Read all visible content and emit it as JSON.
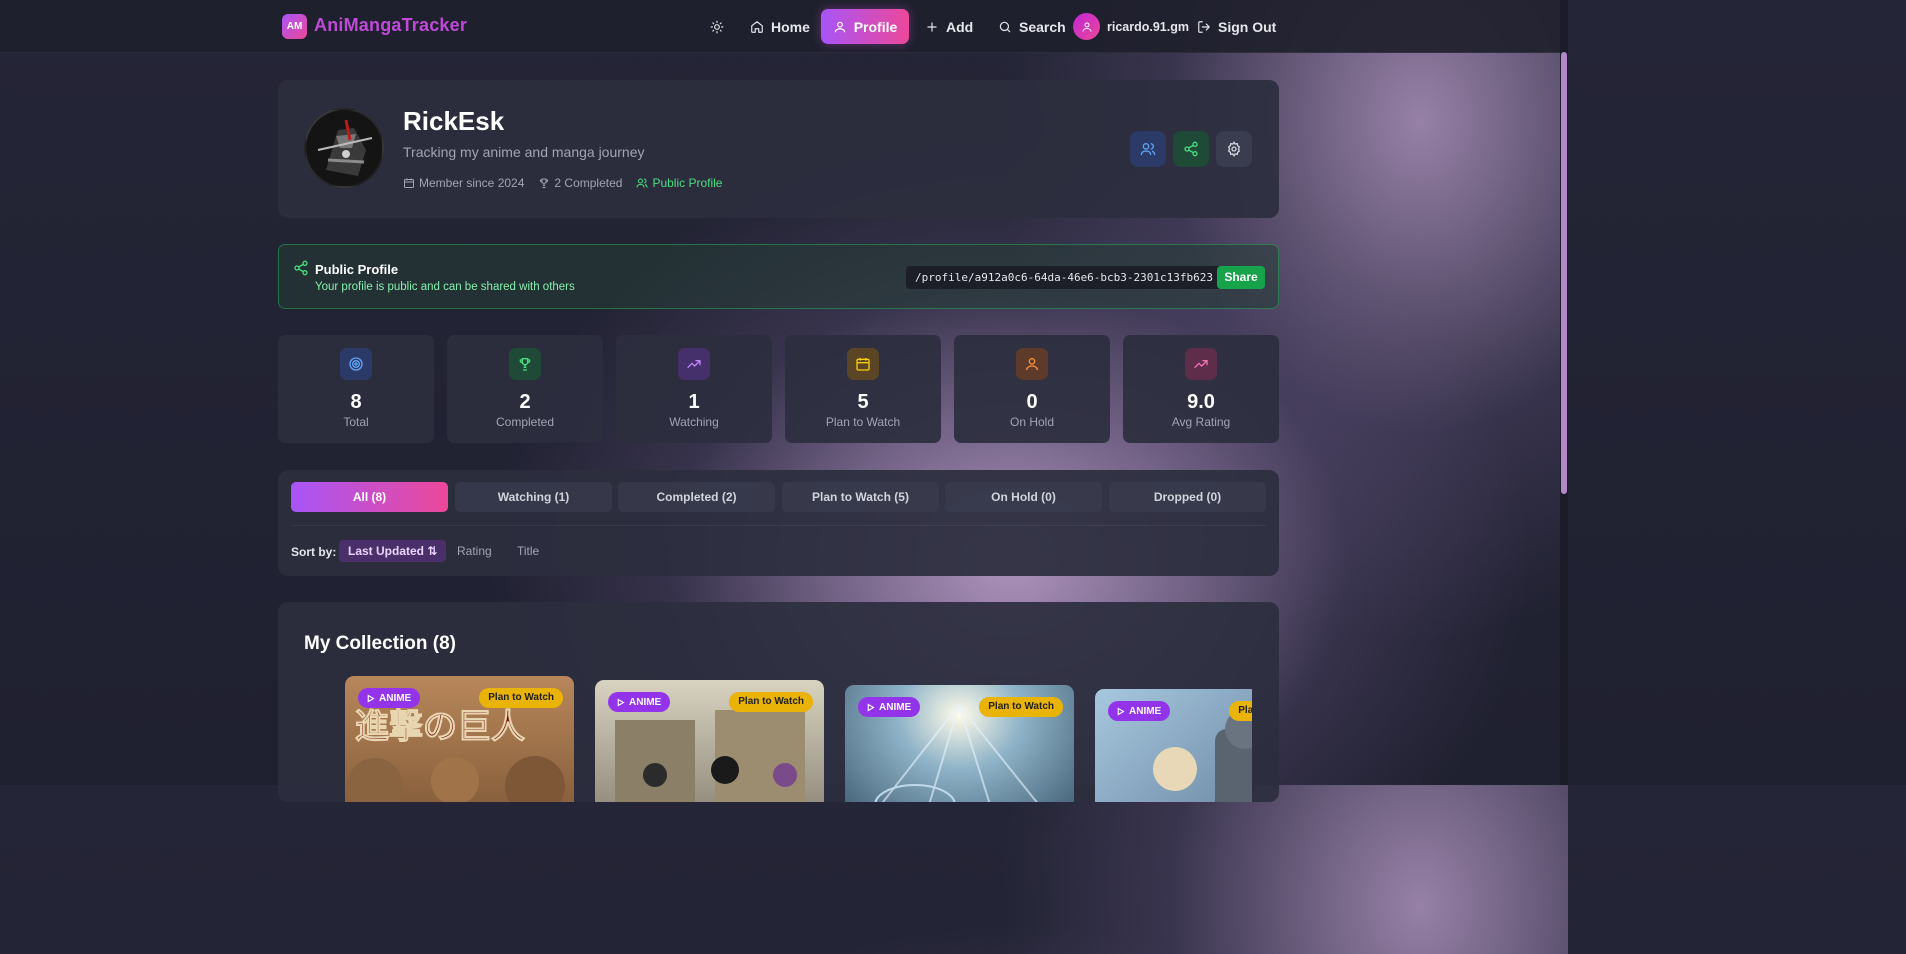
{
  "nav": {
    "logo_mark": "AM",
    "app_name": "AniMangaTracker",
    "home": "Home",
    "profile": "Profile",
    "add": "Add",
    "search": "Search",
    "user_email": "ricardo.91.gm",
    "sign_out": "Sign Out"
  },
  "profile": {
    "username": "RickEsk",
    "bio": "Tracking my anime and manga journey",
    "member_since": "Member since 2024",
    "completed": "2 Completed",
    "visibility": "Public Profile"
  },
  "public_banner": {
    "title": "Public Profile",
    "subtitle": "Your profile is public and can be shared with others",
    "url": "/profile/a912a0c6-64da-46e6-bcb3-2301c13fb623",
    "share_label": "Share"
  },
  "stats": [
    {
      "value": "8",
      "label": "Total",
      "icon": "target-icon",
      "color": "#60a5fa",
      "bg": "#2b3a66"
    },
    {
      "value": "2",
      "label": "Completed",
      "icon": "trophy-icon",
      "color": "#4ade80",
      "bg": "#1f4a37"
    },
    {
      "value": "1",
      "label": "Watching",
      "icon": "trending-up-icon",
      "color": "#c084fc",
      "bg": "#45306b"
    },
    {
      "value": "5",
      "label": "Plan to Watch",
      "icon": "calendar-icon",
      "color": "#facc15",
      "bg": "#5a4525"
    },
    {
      "value": "0",
      "label": "On Hold",
      "icon": "user-icon",
      "color": "#fb923c",
      "bg": "#5e3a2b"
    },
    {
      "value": "9.0",
      "label": "Avg Rating",
      "icon": "trending-up-icon",
      "color": "#f472b6",
      "bg": "#5e2d4a"
    }
  ],
  "tabs": [
    {
      "label": "All (8)",
      "active": true
    },
    {
      "label": "Watching (1)"
    },
    {
      "label": "Completed (2)"
    },
    {
      "label": "Plan to Watch (5)"
    },
    {
      "label": "On Hold (0)"
    },
    {
      "label": "Dropped (0)"
    }
  ],
  "sort": {
    "label": "Sort by:",
    "active": "Last Updated ⇅",
    "rating": "Rating",
    "title": "Title"
  },
  "collection": {
    "title": "My Collection (8)",
    "items": [
      {
        "type": "ANIME",
        "status": "Plan to Watch"
      },
      {
        "type": "ANIME",
        "status": "Plan to Watch"
      },
      {
        "type": "ANIME",
        "status": "Plan to Watch"
      },
      {
        "type": "ANIME",
        "status": "Plan to Watch"
      }
    ]
  },
  "colors": {
    "accent_start": "#a855f7",
    "accent_end": "#ec4899",
    "public_green": "#4ade80",
    "status_yellow": "#eab308"
  }
}
